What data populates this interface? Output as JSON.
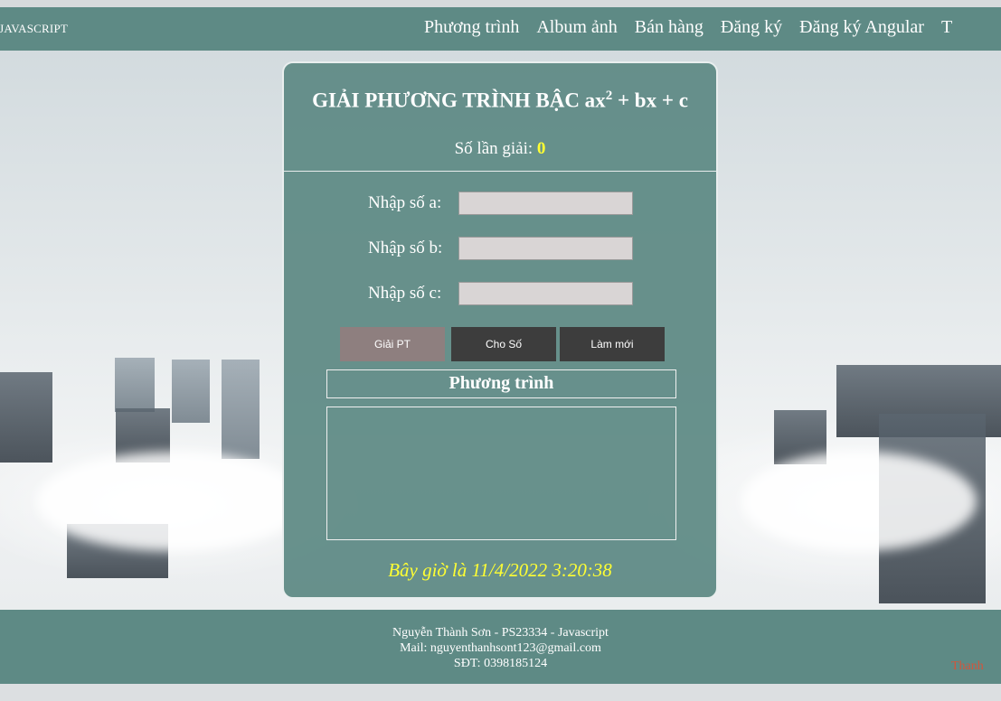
{
  "navbar": {
    "brand": "ENT JAVASCRIPT",
    "items": [
      "Phương trình",
      "Album ảnh",
      "Bán hàng",
      "Đăng ký",
      "Đăng ký Angular",
      "T"
    ]
  },
  "card": {
    "title_prefix": "GIẢI PHƯƠNG TRÌNH BẬC ax",
    "title_sup": "2",
    "title_suffix": " + bx + c",
    "count_label": "Số lần giải: ",
    "count_value": "0",
    "fields": [
      {
        "label": "Nhập số a:",
        "value": ""
      },
      {
        "label": "Nhập số b:",
        "value": ""
      },
      {
        "label": "Nhập số c:",
        "value": ""
      }
    ],
    "buttons": {
      "solve": "Giải PT",
      "random": "Cho Số",
      "reset": "Làm mới"
    },
    "equation_heading": "Phương trình",
    "result_text": "",
    "clock": "Bây giờ là 11/4/2022 3:20:38"
  },
  "footer": {
    "line1": "Nguyễn Thành Sơn - PS23334 - Javascript",
    "line2": "Mail: nguyenthanhsont123@gmail.com",
    "line3": "SĐT: 0398185124",
    "watermark": "Thanh"
  },
  "colors": {
    "panel": "#5e8a85",
    "highlight": "#ffff33",
    "solve_button": "#8e7f7f",
    "dark_button": "#3d3d3d"
  }
}
